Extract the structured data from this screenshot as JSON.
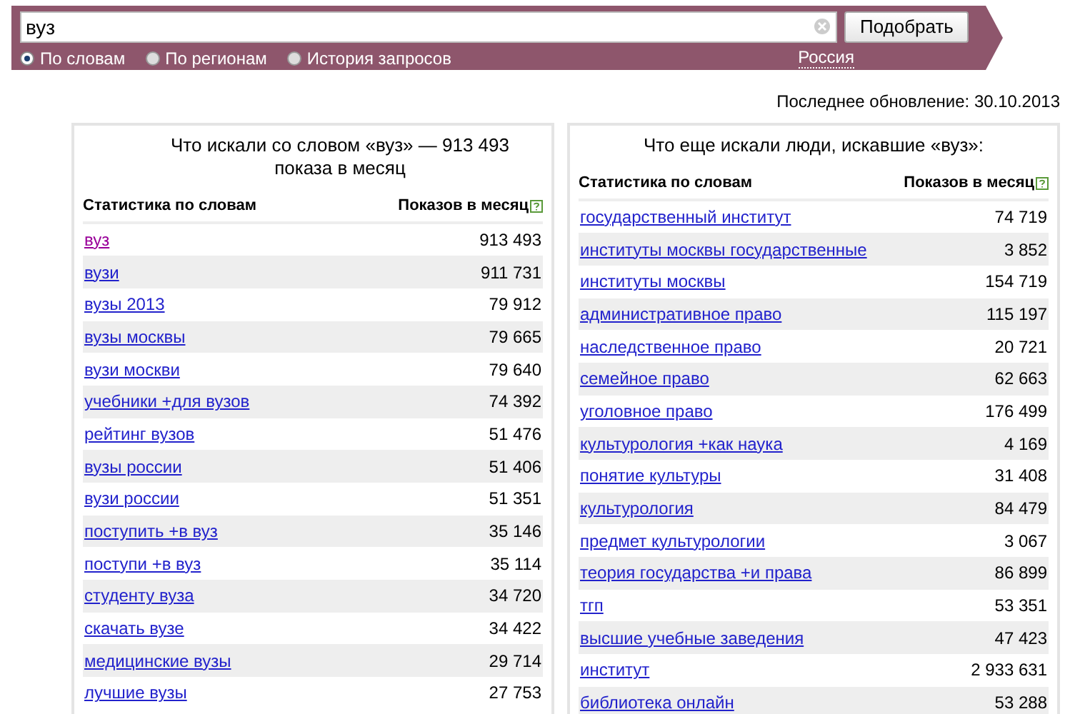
{
  "search": {
    "value": "вуз",
    "button": "Подобрать"
  },
  "modes": [
    {
      "label": "По словам",
      "selected": true
    },
    {
      "label": "По регионам",
      "selected": false
    },
    {
      "label": "История запросов",
      "selected": false
    }
  ],
  "region": "Россия",
  "last_update": "Последнее обновление: 30.10.2013",
  "panels": [
    {
      "title": "Что искали со словом «вуз» — 913 493 показа в месяц",
      "columns": [
        "Статистика по словам",
        "Показов в месяц"
      ],
      "rows": [
        {
          "phrase": "вуз",
          "count": "913 493",
          "visited": true
        },
        {
          "phrase": "вузи",
          "count": "911 731",
          "visited": false
        },
        {
          "phrase": "вузы 2013",
          "count": "79 912",
          "visited": false
        },
        {
          "phrase": "вузы москвы",
          "count": "79 665",
          "visited": false
        },
        {
          "phrase": "вузи москви",
          "count": "79 640",
          "visited": false
        },
        {
          "phrase": "учебники +для вузов",
          "count": "74 392",
          "visited": false
        },
        {
          "phrase": "рейтинг вузов",
          "count": "51 476",
          "visited": false
        },
        {
          "phrase": "вузы россии",
          "count": "51 406",
          "visited": false
        },
        {
          "phrase": "вузи россии",
          "count": "51 351",
          "visited": false
        },
        {
          "phrase": "поступить +в вуз",
          "count": "35 146",
          "visited": false
        },
        {
          "phrase": "поступи +в вуз",
          "count": "35 114",
          "visited": false
        },
        {
          "phrase": "студенту вуза",
          "count": "34 720",
          "visited": false
        },
        {
          "phrase": "скачать вузе",
          "count": "34 422",
          "visited": false
        },
        {
          "phrase": "медицинские вузы",
          "count": "29 714",
          "visited": false
        },
        {
          "phrase": "лучшие вузы",
          "count": "27 753",
          "visited": false
        }
      ]
    },
    {
      "title": "Что еще искали люди, искавшие «вуз»:",
      "columns": [
        "Статистика по словам",
        "Показов в месяц"
      ],
      "rows": [
        {
          "phrase": "государственный институт",
          "count": "74 719",
          "visited": false
        },
        {
          "phrase": "институты москвы государственные",
          "count": "3 852",
          "visited": false
        },
        {
          "phrase": "институты москвы",
          "count": "154 719",
          "visited": false
        },
        {
          "phrase": "административное право",
          "count": "115 197",
          "visited": false
        },
        {
          "phrase": "наследственное право",
          "count": "20 721",
          "visited": false
        },
        {
          "phrase": "семейное право",
          "count": "62 663",
          "visited": false
        },
        {
          "phrase": "уголовное право",
          "count": "176 499",
          "visited": false
        },
        {
          "phrase": "культурология +как наука",
          "count": "4 169",
          "visited": false
        },
        {
          "phrase": "понятие культуры",
          "count": "31 408",
          "visited": false
        },
        {
          "phrase": "культурология",
          "count": "84 479",
          "visited": false
        },
        {
          "phrase": "предмет культурологии",
          "count": "3 067",
          "visited": false
        },
        {
          "phrase": "теория государства +и права",
          "count": "86 899",
          "visited": false
        },
        {
          "phrase": "тгп",
          "count": "53 351",
          "visited": false
        },
        {
          "phrase": "высшие учебные заведения",
          "count": "47 423",
          "visited": false
        },
        {
          "phrase": "институт",
          "count": "2 933 631",
          "visited": false
        },
        {
          "phrase": "библиотека онлайн",
          "count": "53 288",
          "visited": false
        }
      ]
    }
  ]
}
